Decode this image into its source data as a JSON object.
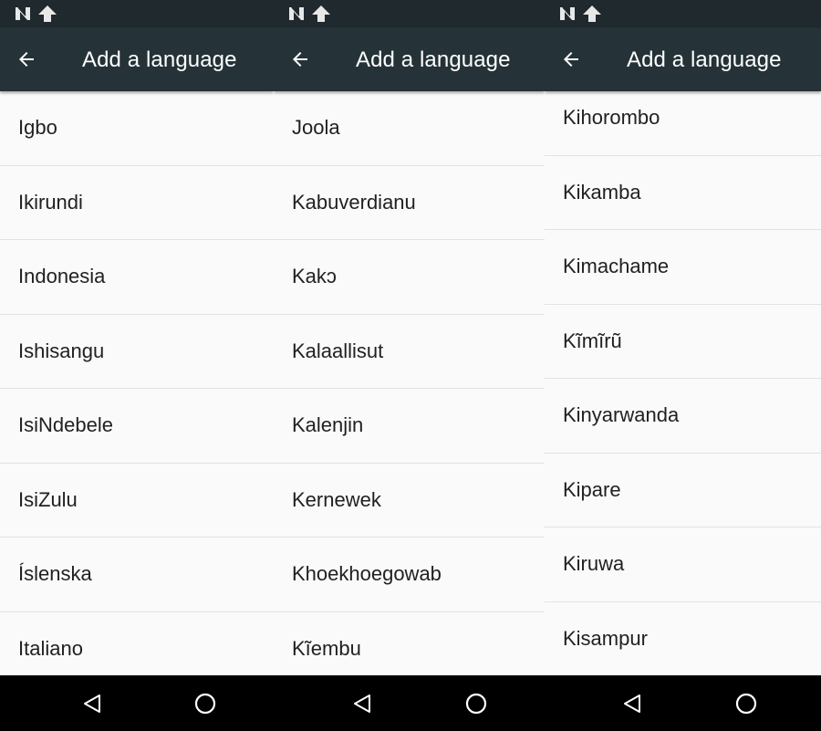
{
  "screens": [
    {
      "title": "Add a language",
      "items": [
        "Igbo",
        "Ikirundi",
        "Indonesia",
        "Ishisangu",
        "IsiNdebele",
        "IsiZulu",
        "Íslenska",
        "Italiano"
      ]
    },
    {
      "title": "Add a language",
      "items": [
        "Joola",
        "Kabuverdianu",
        "Kakɔ",
        "Kalaallisut",
        "Kalenjin",
        "Kernewek",
        "Khoekhoegowab",
        "Kĩembu"
      ]
    },
    {
      "title": "Add a language",
      "items": [
        "Kihorombo",
        "Kikamba",
        "Kimachame",
        "Kĩmĩrũ",
        "Kinyarwanda",
        "Kipare",
        "Kiruwa",
        "Kisampur"
      ]
    }
  ],
  "icons": {
    "status_notification": "n-notification-icon",
    "status_upload": "upload-arrow-icon",
    "back": "arrow-left-icon",
    "nav_back": "triangle-back-icon",
    "nav_home": "circle-home-icon"
  },
  "colors": {
    "status_bar": "#1f292e",
    "app_bar": "#253238",
    "list_background": "#fafafa",
    "divider": "#e2e2e2",
    "text_primary": "#212121",
    "nav_bar": "#000000"
  }
}
